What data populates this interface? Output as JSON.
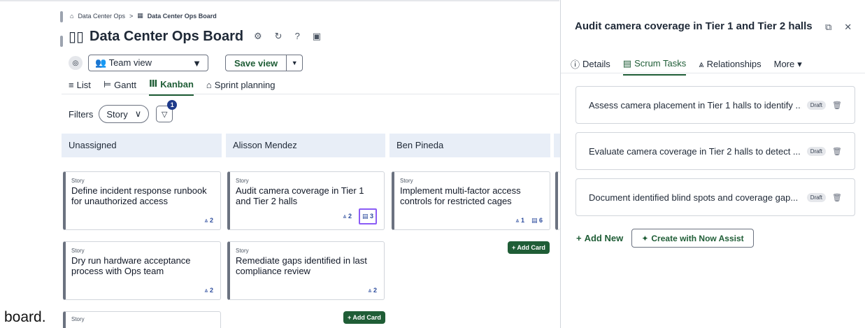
{
  "breadcrumb": {
    "home": "Data Center Ops",
    "separator": ">",
    "current": "Data Center Ops Board"
  },
  "board": {
    "title": "Data Center Ops Board"
  },
  "view": {
    "selected": "Team view",
    "save_label": "Save view"
  },
  "tabs": [
    {
      "label": "List"
    },
    {
      "label": "Gantt"
    },
    {
      "label": "Kanban"
    },
    {
      "label": "Sprint planning"
    }
  ],
  "filters": {
    "label": "Filters",
    "story": "Story",
    "badge": "1"
  },
  "columns": [
    {
      "title": "Unassigned"
    },
    {
      "title": "Alisson Mendez"
    },
    {
      "title": "Ben Pineda"
    }
  ],
  "cards": {
    "c1": {
      "type": "Story",
      "title": "Define incident response runbook for unauthorized access",
      "rel": "2"
    },
    "c2": {
      "type": "Story",
      "title": "Dry run hardware acceptance process with Ops team",
      "rel": "2"
    },
    "c3": {
      "type": "Story",
      "title": "Audit camera coverage in Tier 1 and Tier 2 halls",
      "rel": "2",
      "tasks": "3"
    },
    "c4": {
      "type": "Story",
      "title": "Remediate gaps identified in last compliance review",
      "rel": "2"
    },
    "c5": {
      "type": "Story",
      "title": "Implement multi-factor access controls for restricted cages",
      "rel": "1",
      "tasks": "6"
    },
    "c6": {
      "type": "Story"
    }
  },
  "add_card_label": "+ Add Card",
  "caption": "board.",
  "panel": {
    "title": "Audit camera coverage in Tier 1 and Tier 2 halls",
    "tabs": [
      {
        "label": "Details"
      },
      {
        "label": "Scrum Tasks"
      },
      {
        "label": "Relationships"
      },
      {
        "label": "More"
      }
    ],
    "tasks": [
      {
        "text": "Assess camera placement in Tier 1 halls to identify ...",
        "status": "Draft"
      },
      {
        "text": "Evaluate camera coverage in Tier 2 halls to detect ...",
        "status": "Draft"
      },
      {
        "text": "Document identified blind spots and coverage gap...",
        "status": "Draft"
      }
    ],
    "add_new": "Add New",
    "assist": "Create with Now Assist"
  },
  "colors": {
    "accent": "#1f5d36",
    "column_header": "#e8eef7",
    "highlight": "#8b5cf6"
  }
}
